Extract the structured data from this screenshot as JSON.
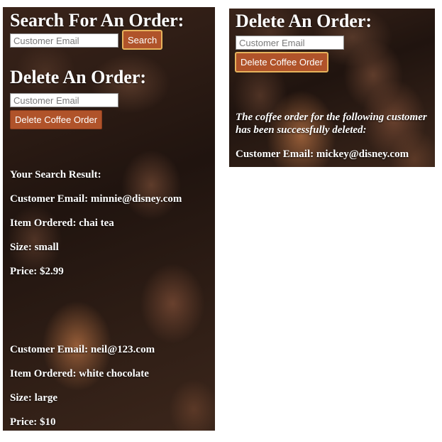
{
  "left_panel": {
    "search_heading": "Search For An Order:",
    "search_input": {
      "placeholder": "Customer Email",
      "value": ""
    },
    "search_button": "Search",
    "delete_heading": "Delete An Order:",
    "delete_input": {
      "placeholder": "Customer Email",
      "value": ""
    },
    "delete_button": "Delete Coffee Order",
    "result_heading": "Your Search Result:",
    "orders": [
      {
        "email": "Customer Email: minnie@disney.com",
        "item": "Item Ordered: chai tea",
        "size": "Size: small",
        "price": "Price: $2.99"
      },
      {
        "email": "Customer Email: neil@123.com",
        "item": "Item Ordered: white chocolate",
        "size": "Size: large",
        "price": "Price: $10"
      }
    ]
  },
  "right_panel": {
    "delete_heading": "Delete An Order:",
    "delete_input": {
      "placeholder": "Customer Email",
      "value": ""
    },
    "delete_button": "Delete Coffee Order",
    "success_message": "The coffee order for the following customer has been successfully deleted:",
    "deleted_email": "Customer Email: mickey@disney.com"
  },
  "colors": {
    "button_bg": "#b0532a",
    "button_focus_border": "#e6b25c",
    "text": "#ffffff"
  }
}
